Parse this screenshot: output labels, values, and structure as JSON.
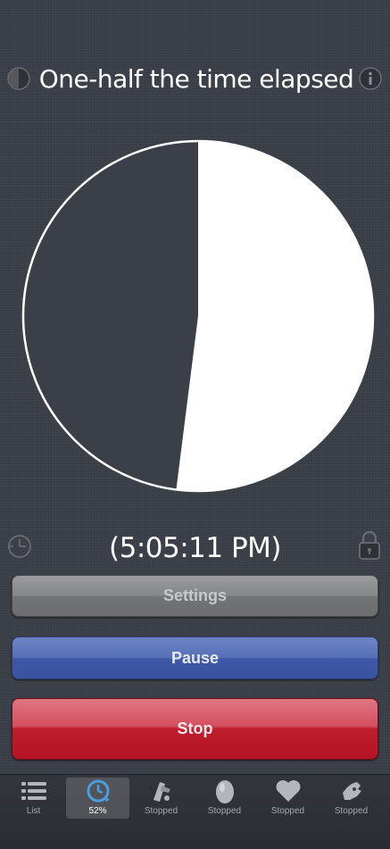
{
  "header": {
    "title": "One-half the time elapsed",
    "left_icon": "half-moon-icon",
    "right_icon": "info-icon"
  },
  "timer": {
    "elapsed_fraction": 0.52,
    "time_display": "(5:05:11 PM)",
    "left_icon": "clock-icon",
    "right_icon": "lock-icon"
  },
  "buttons": {
    "settings_label": "Settings",
    "pause_label": "Pause",
    "stop_label": "Stop"
  },
  "tabbar": {
    "items": [
      {
        "label": "List",
        "icon": "list-icon",
        "selected": false
      },
      {
        "label": "52%",
        "icon": "timer-clock-icon",
        "selected": true
      },
      {
        "label": "Stopped",
        "icon": "megaphone-icon",
        "selected": false
      },
      {
        "label": "Stopped",
        "icon": "egg-icon",
        "selected": false
      },
      {
        "label": "Stopped",
        "icon": "heart-icon",
        "selected": false
      },
      {
        "label": "Stopped",
        "icon": "hand-icon",
        "selected": false
      }
    ]
  },
  "colors": {
    "background": "#3b3f47",
    "pie_fill": "#ffffff",
    "settings_button": "#85868a",
    "pause_button": "#4a64ae",
    "stop_button": "#c21c2b",
    "tab_selected_icon": "#4a9fe0"
  }
}
